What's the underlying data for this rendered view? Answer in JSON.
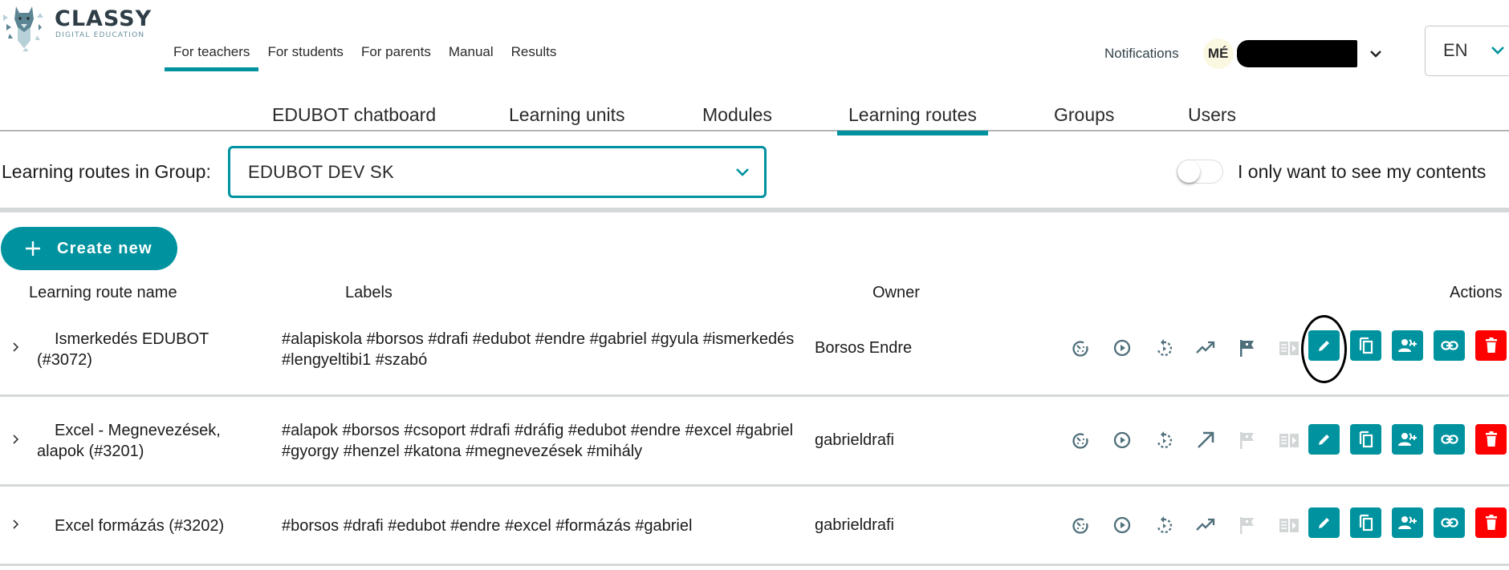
{
  "brand": {
    "name": "CLASSY",
    "tagline": "DIGITAL EDUCATION"
  },
  "top_nav": {
    "items": [
      {
        "label": "For teachers",
        "active": true
      },
      {
        "label": "For students",
        "active": false
      },
      {
        "label": "For parents",
        "active": false
      },
      {
        "label": "Manual",
        "active": false
      },
      {
        "label": "Results",
        "active": false
      }
    ]
  },
  "user": {
    "notifications_label": "Notifications",
    "initials": "MÉ",
    "name_redacted": true,
    "language": "EN"
  },
  "sub_nav": {
    "items": [
      {
        "label": "EDUBOT chatboard",
        "active": false
      },
      {
        "label": "Learning units",
        "active": false
      },
      {
        "label": "Modules",
        "active": false
      },
      {
        "label": "Learning routes",
        "active": true
      },
      {
        "label": "Groups",
        "active": false
      },
      {
        "label": "Users",
        "active": false
      }
    ]
  },
  "filter": {
    "group_label": "Learning routes in Group:",
    "group_value": "EDUBOT DEV SK",
    "toggle_label": "I only want to see my contents",
    "toggle_on": false
  },
  "create_button": {
    "label": "Create new"
  },
  "table": {
    "headers": {
      "name": "Learning route name",
      "labels": "Labels",
      "owner": "Owner",
      "actions": "Actions"
    },
    "status_icons": [
      "timer-icon",
      "play-icon",
      "replay-icon",
      "trend-icon",
      "flag-icon",
      "book-icon"
    ],
    "action_buttons": [
      "edit",
      "copy",
      "share-users",
      "link",
      "delete"
    ],
    "rows": [
      {
        "name_line1": "Ismerkedés EDUBOT",
        "name_line2": "(#3072)",
        "labels": "#alapiskola #borsos #drafi #edubot #endre #gabriel #gyula #ismerkedés #lengyeltibi1 #szabó",
        "owner": "Borsos Endre",
        "trend": "trending",
        "flag_active": true
      },
      {
        "name_line1": "Excel - Megnevezések,",
        "name_line2": "alapok (#3201)",
        "labels": "#alapok #borsos #csoport #drafi #dráfig #edubot #endre #excel #gabriel #gyorgy #henzel #katona #megnevezések #mihály",
        "owner": "gabrieldrafi",
        "trend": "arrow",
        "flag_active": false
      },
      {
        "name_line1": "Excel formázás (#3202)",
        "name_line2": "",
        "labels": "#borsos #drafi #edubot #endre #excel #formázás #gabriel",
        "owner": "gabrieldrafi",
        "trend": "trending",
        "flag_active": false
      }
    ]
  },
  "colors": {
    "accent": "#00939f",
    "danger": "#ff0000",
    "icon": "#4f6f7b",
    "icon_disabled": "#d3d6d7"
  }
}
